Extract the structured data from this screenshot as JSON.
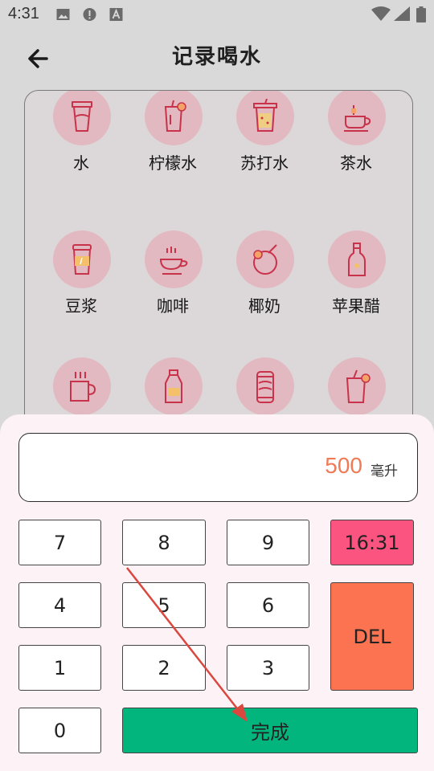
{
  "status_bar": {
    "time": "4:31"
  },
  "header": {
    "title": "记录喝水"
  },
  "drinks": [
    {
      "label": "水",
      "icon": "water-cup-icon"
    },
    {
      "label": "柠檬水",
      "icon": "lemonade-icon"
    },
    {
      "label": "苏打水",
      "icon": "soda-cup-icon"
    },
    {
      "label": "茶水",
      "icon": "tea-cup-icon"
    },
    {
      "label": "豆浆",
      "icon": "soy-milk-cup-icon"
    },
    {
      "label": "咖啡",
      "icon": "coffee-cup-icon"
    },
    {
      "label": "椰奶",
      "icon": "coconut-icon"
    },
    {
      "label": "苹果醋",
      "icon": "vinegar-bottle-icon"
    },
    {
      "label": "",
      "icon": "mug-icon"
    },
    {
      "label": "",
      "icon": "milk-bottle-icon"
    },
    {
      "label": "",
      "icon": "can-icon"
    },
    {
      "label": "",
      "icon": "juice-glass-icon"
    }
  ],
  "input": {
    "amount": "500",
    "unit": "毫升"
  },
  "keypad": {
    "k7": "7",
    "k8": "8",
    "k9": "9",
    "k4": "4",
    "k5": "5",
    "k6": "6",
    "k1": "1",
    "k2": "2",
    "k3": "3",
    "k0": "0",
    "time": "16:31",
    "del": "DEL",
    "done": "完成"
  },
  "colors": {
    "accent_amount": "#f07a57",
    "time_key": "#fb5480",
    "del_key": "#fc7352",
    "done_key": "#02b57d",
    "icon_stroke": "#c8324a"
  }
}
